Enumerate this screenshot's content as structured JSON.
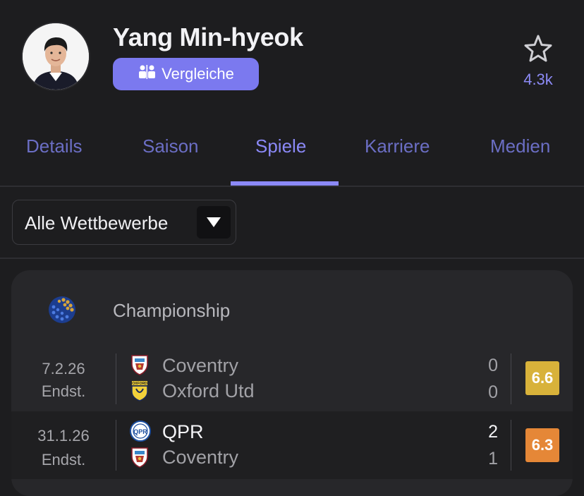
{
  "player": {
    "name": "Yang Min-hyeok",
    "compare_label": "Vergleiche",
    "follow_count": "4.3k"
  },
  "tabs": [
    {
      "label": "Details",
      "active": false
    },
    {
      "label": "Saison",
      "active": false
    },
    {
      "label": "Spiele",
      "active": true
    },
    {
      "label": "Karriere",
      "active": false
    },
    {
      "label": "Medien",
      "active": false
    }
  ],
  "filter": {
    "selected": "Alle Wettbewerbe"
  },
  "competition": {
    "name": "Championship"
  },
  "matches": [
    {
      "date": "7.2.26",
      "status": "Endst.",
      "home": {
        "name": "Coventry",
        "score": "0"
      },
      "away": {
        "name": "Oxford Utd",
        "score": "0"
      },
      "rating": "6.6",
      "rating_color": "#d8b23a"
    },
    {
      "date": "31.1.26",
      "status": "Endst.",
      "home": {
        "name": "QPR",
        "score": "2"
      },
      "away": {
        "name": "Coventry",
        "score": "1"
      },
      "rating": "6.3",
      "rating_color": "#e58737"
    }
  ],
  "colors": {
    "accent": "#8b89f7",
    "button": "#7b79ef",
    "background": "#1d1d1f",
    "card": "#27272a"
  },
  "icons": {
    "star": "star-icon",
    "compare": "compare-people-icon",
    "caret": "caret-down-icon"
  }
}
